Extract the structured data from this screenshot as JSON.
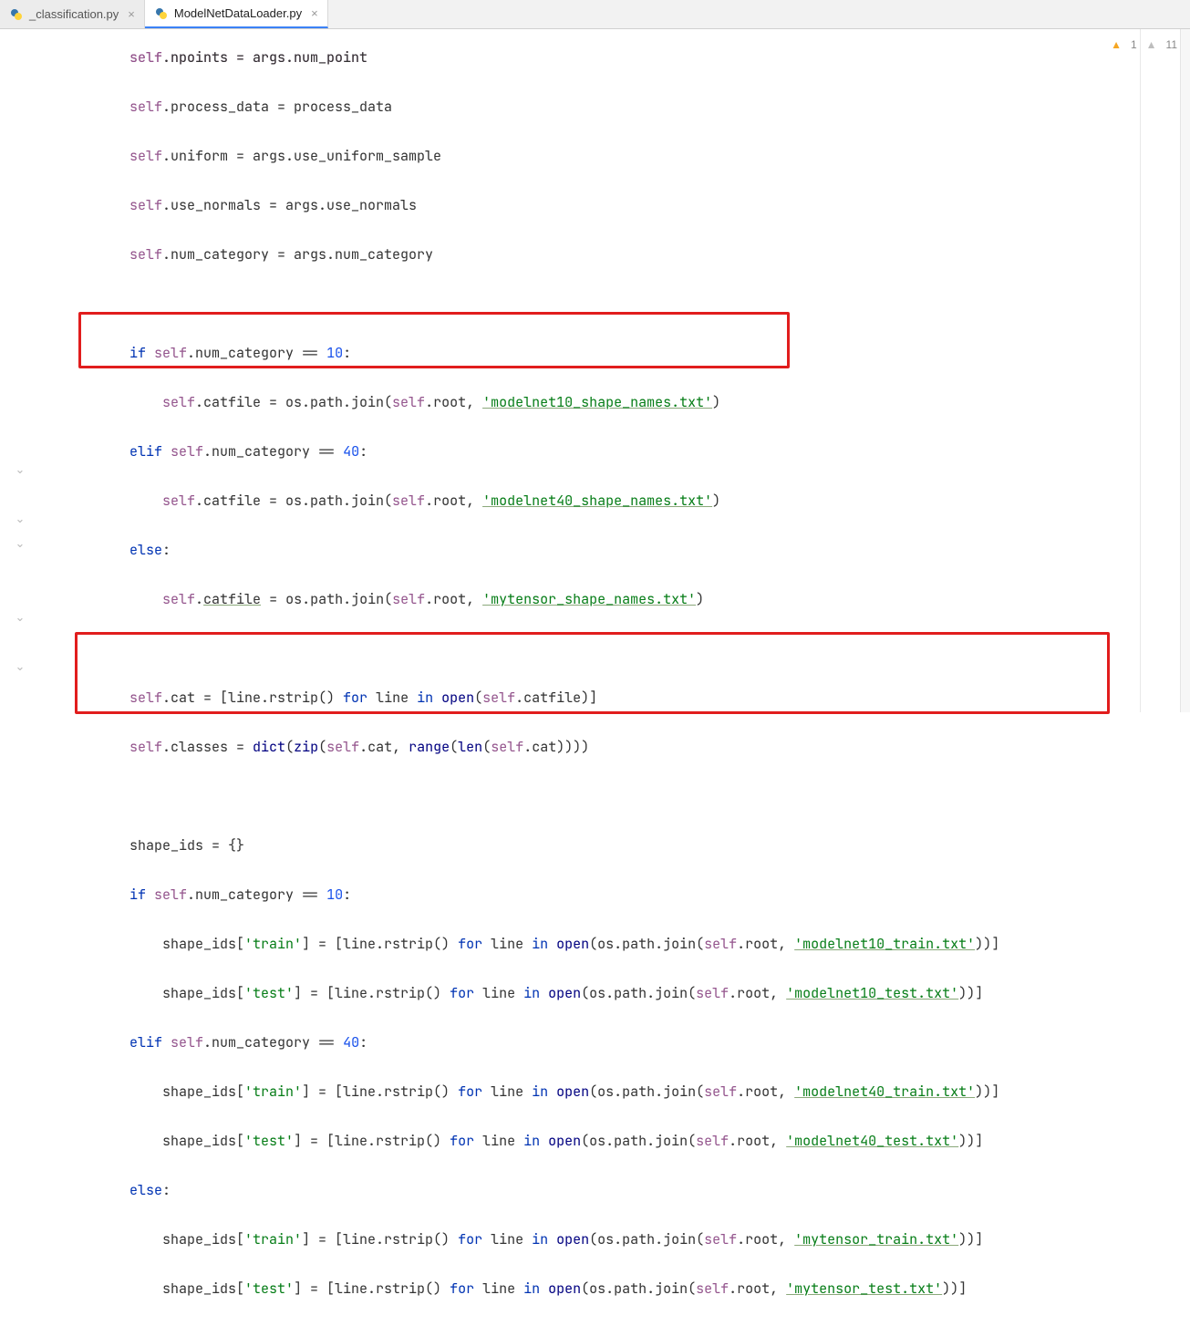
{
  "tabs": [
    {
      "label": "_classification.py",
      "active": false
    },
    {
      "label": "ModelNetDataLoader.py",
      "active": true
    }
  ],
  "inspections": {
    "warnings": "1",
    "weak_warnings": "11"
  },
  "code": {
    "l0": "self.npoints = args.num_point",
    "l1": "self.process_data = process_data",
    "l2": "self.uniform = args.use_uniform_sample",
    "l3": "self.use_normals = args.use_normals",
    "l4": "self.num_category = args.num_category",
    "l5": "",
    "l6a": "if ",
    "l6b": "self",
    "l6c": ".num_category == ",
    "l6d": "10",
    "l6e": ":",
    "l7a": "self",
    "l7b": ".catfile = os.path.join(",
    "l7c": "self",
    "l7d": ".root, ",
    "l7e": "'modelnet10_shape_names.txt'",
    "l7f": ")",
    "l8a": "elif ",
    "l8b": "self",
    "l8c": ".num_category == ",
    "l8d": "40",
    "l8e": ":",
    "l9a": "self",
    "l9b": ".catfile = os.path.join(",
    "l9c": "self",
    "l9d": ".root, ",
    "l9e": "'modelnet40_shape_names.txt'",
    "l9f": ")",
    "l10a": "else",
    "l10b": ":",
    "l11a": "self",
    "l11b": ".",
    "l11c": "catfile",
    "l11d": " = os.path.join(",
    "l11e": "self",
    "l11f": ".root, ",
    "l11g": "'mytensor_shape_names.txt'",
    "l11h": ")",
    "l12": "",
    "l13a": "self",
    "l13b": ".cat = [line.rstrip() ",
    "l13c": "for ",
    "l13d": "line ",
    "l13e": "in ",
    "l13f": "open",
    "l13g": "(",
    "l13h": "self",
    "l13i": ".catfile)]",
    "l14a": "self",
    "l14b": ".classes = ",
    "l14c": "dict",
    "l14d": "(",
    "l14e": "zip",
    "l14f": "(",
    "l14g": "self",
    "l14h": ".cat, ",
    "l14i": "range",
    "l14j": "(",
    "l14k": "len",
    "l14l": "(",
    "l14m": "self",
    "l14n": ".cat))))",
    "l15": "",
    "l16": "shape_ids = {}",
    "l17a": "if ",
    "l17b": "self",
    "l17c": ".num_category == ",
    "l17d": "10",
    "l17e": ":",
    "l18a": "shape_ids[",
    "l18b": "'train'",
    "l18c": "] = [line.rstrip() ",
    "l18d": "for ",
    "l18e": "line ",
    "l18f": "in ",
    "l18g": "open",
    "l18h": "(os.path.join(",
    "l18i": "self",
    "l18j": ".root, ",
    "l18k": "'modelnet10_train.txt'",
    "l18l": "))]",
    "l19a": "shape_ids[",
    "l19b": "'test'",
    "l19c": "] = [line.rstrip() ",
    "l19d": "for ",
    "l19e": "line ",
    "l19f": "in ",
    "l19g": "open",
    "l19h": "(os.path.join(",
    "l19i": "self",
    "l19j": ".root, ",
    "l19k": "'modelnet10_test.txt'",
    "l19l": "))]",
    "l20a": "elif ",
    "l20b": "self",
    "l20c": ".num_category == ",
    "l20d": "40",
    "l20e": ":",
    "l21a": "shape_ids[",
    "l21b": "'train'",
    "l21c": "] = [line.rstrip() ",
    "l21d": "for ",
    "l21e": "line ",
    "l21f": "in ",
    "l21g": "open",
    "l21h": "(os.path.join(",
    "l21i": "self",
    "l21j": ".root, ",
    "l21k": "'modelnet40_train.txt'",
    "l21l": "))]",
    "l22a": "shape_ids[",
    "l22b": "'test'",
    "l22c": "] = [line.rstrip() ",
    "l22d": "for ",
    "l22e": "line ",
    "l22f": "in ",
    "l22g": "open",
    "l22h": "(os.path.join(",
    "l22i": "self",
    "l22j": ".root, ",
    "l22k": "'modelnet40_test.txt'",
    "l22l": "))]",
    "l23a": "else",
    "l23b": ":",
    "l24a": "shape_ids[",
    "l24b": "'train'",
    "l24c": "] = [line.rstrip() ",
    "l24d": "for ",
    "l24e": "line ",
    "l24f": "in ",
    "l24g": "open",
    "l24h": "(os.path.join(",
    "l24i": "self",
    "l24j": ".root, ",
    "l24k": "'mytensor_train.txt'",
    "l24l": "))]",
    "l25a": "shape_ids[",
    "l25b": "'test'",
    "l25c": "] = [line.rstrip() ",
    "l25d": "for ",
    "l25e": "line ",
    "l25f": "in ",
    "l25g": "open",
    "l25h": "(os.path.join(",
    "l25i": "self",
    "l25j": ".root, ",
    "l25k": "'mytensor_test.txt'",
    "l25l": "))]"
  }
}
